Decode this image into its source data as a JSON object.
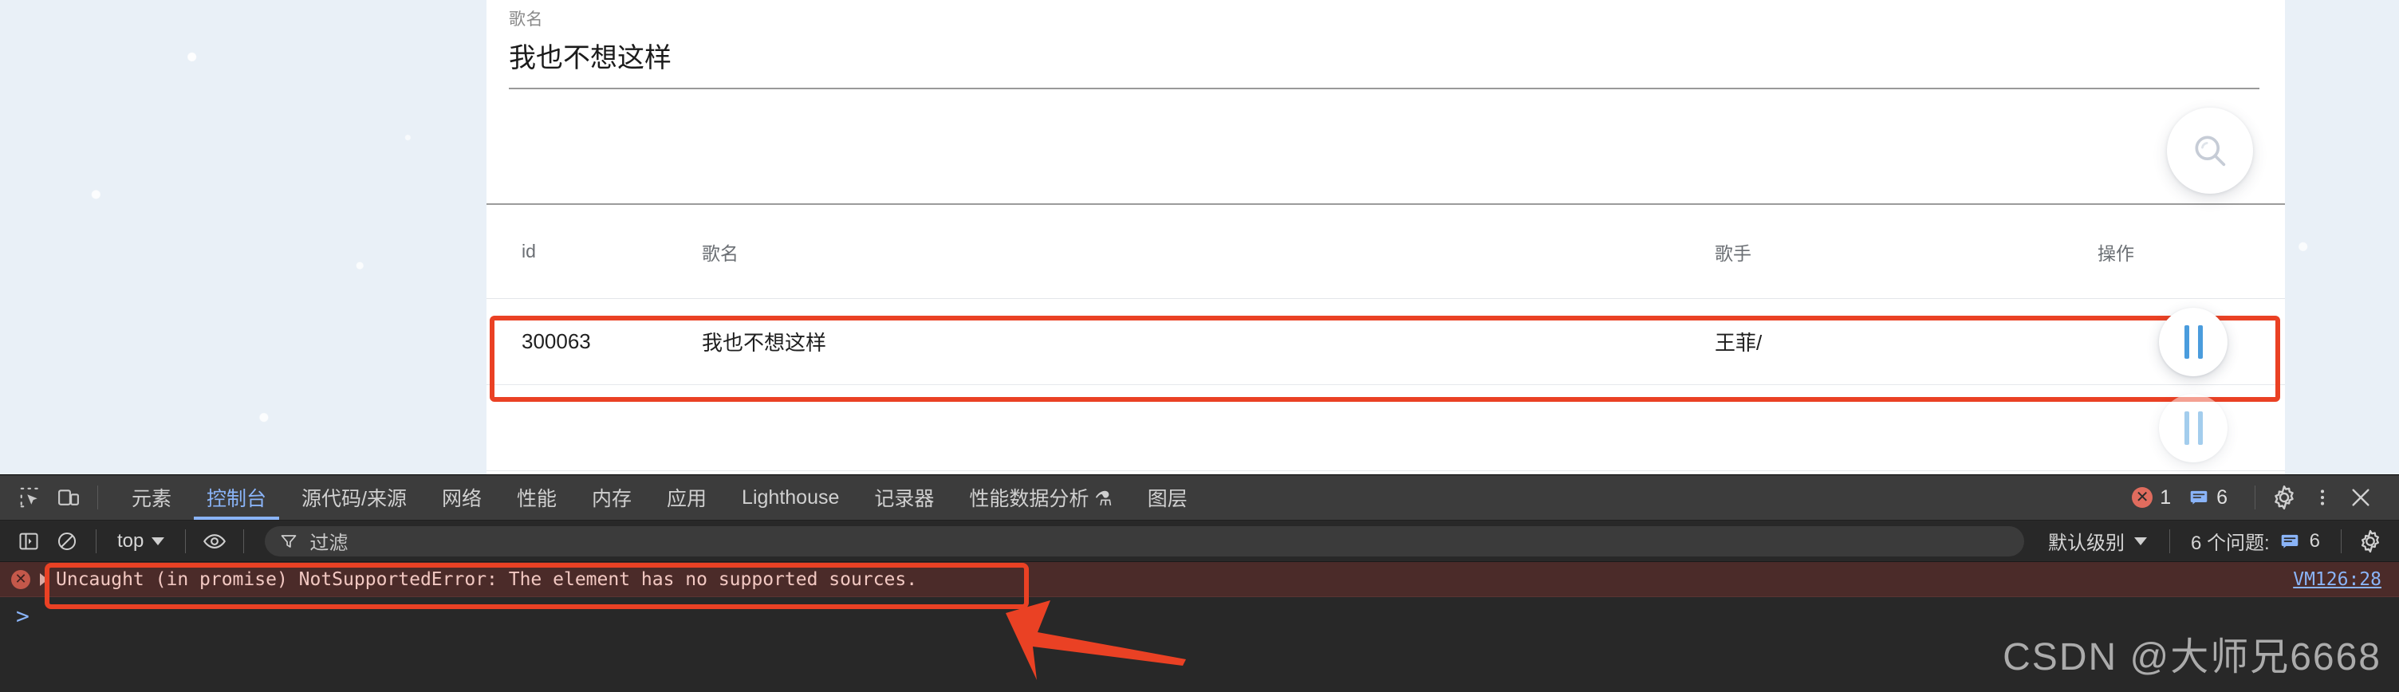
{
  "page": {
    "form": {
      "label": "歌名",
      "value": "我也不想这样",
      "search_icon": "search-icon"
    },
    "table": {
      "columns": [
        "id",
        "歌名",
        "歌手",
        "操作"
      ],
      "rows": [
        {
          "id": "300063",
          "song": "我也不想这样",
          "singer": "王菲/",
          "action_icon": "pause-icon"
        }
      ]
    }
  },
  "devtools": {
    "icons": {
      "inspect": "inspect-element-icon",
      "device": "device-toolbar-icon",
      "sidebar": "console-sidebar-icon",
      "clear": "clear-console-icon",
      "eye": "live-expression-eye-icon",
      "filter": "filter-funnel-icon",
      "settings": "gear-icon",
      "more": "more-options-icon",
      "close": "close-icon",
      "message": "message-icon",
      "error": "error-icon",
      "flask": "flask-icon"
    },
    "tabs": [
      {
        "label": "元素",
        "active": false
      },
      {
        "label": "控制台",
        "active": true
      },
      {
        "label": "源代码/来源",
        "active": false
      },
      {
        "label": "网络",
        "active": false
      },
      {
        "label": "性能",
        "active": false
      },
      {
        "label": "内存",
        "active": false
      },
      {
        "label": "应用",
        "active": false
      },
      {
        "label": "Lighthouse",
        "active": false
      },
      {
        "label": "记录器",
        "active": false
      },
      {
        "label": "性能数据分析 ⚗",
        "active": false
      },
      {
        "label": "图层",
        "active": false
      }
    ],
    "status": {
      "error_count": "1",
      "message_count": "6"
    },
    "filterbar": {
      "context": "top",
      "filter_placeholder": "过滤",
      "level": "默认级别",
      "issues_label": "6 个问题:",
      "issues_count": "6"
    },
    "console": {
      "error_message": "Uncaught (in promise) NotSupportedError: The element has no supported sources.",
      "error_source": "VM126:28",
      "prompt": ">"
    }
  },
  "watermark": "CSDN @大师兄6668",
  "colors": {
    "accent_red": "#ea4124",
    "link_blue": "#8ab4f8",
    "page_bg": "#e9f0f7",
    "devtools_bg": "#282828"
  }
}
